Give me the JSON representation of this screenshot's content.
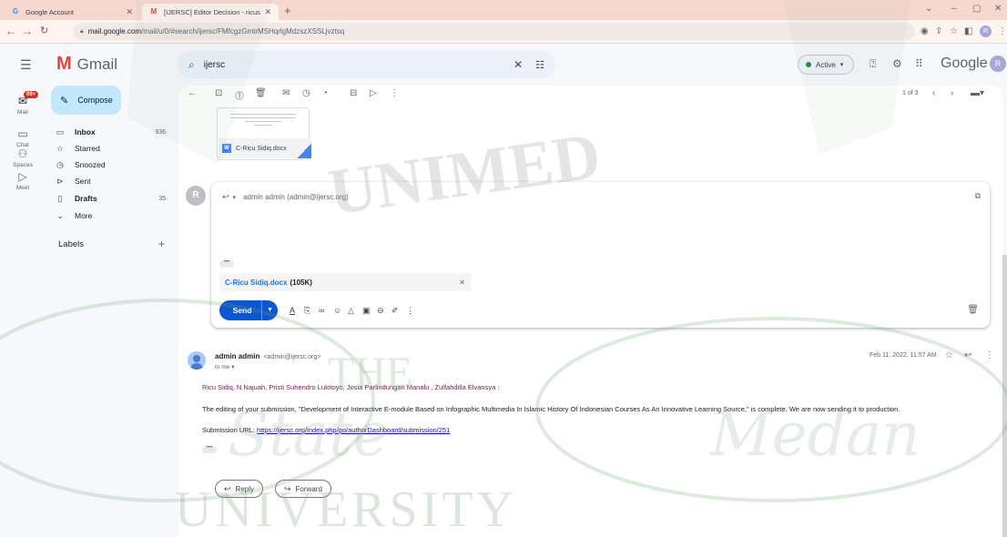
{
  "browser": {
    "tabs": [
      {
        "favicon": "G",
        "title": "Google Account"
      },
      {
        "favicon": "M",
        "title": "[IJERSC] Editor Decision - ricusid"
      }
    ],
    "url_host": "mail.google.com",
    "url_path": "/mail/u/0/#search/ijersc/FMfcgzGmtrMSHqrlgMdzszXSSLjvztsq",
    "profile_initial": "R"
  },
  "gmail": {
    "logo_text": "Gmail",
    "search_query": "ijersc",
    "status": "Active",
    "google_word": "Google",
    "avatar_initial": "R"
  },
  "rail": {
    "mail_badge": "99+",
    "items": [
      {
        "label": "Mail"
      },
      {
        "label": "Chat"
      },
      {
        "label": "Spaces"
      },
      {
        "label": "Meet"
      }
    ]
  },
  "sidebar": {
    "compose_label": "Compose",
    "items": [
      {
        "label": "Inbox",
        "count": "936"
      },
      {
        "label": "Starred",
        "count": ""
      },
      {
        "label": "Snoozed",
        "count": ""
      },
      {
        "label": "Sent",
        "count": ""
      },
      {
        "label": "Drafts",
        "count": "35"
      },
      {
        "label": "More",
        "count": ""
      }
    ],
    "labels_heading": "Labels"
  },
  "toolbar": {
    "pager": "1 of 3"
  },
  "thread": {
    "attachment_preview_name": "C-Ricu Sidiq.docx",
    "reply": {
      "avatar_initial": "R",
      "to": "admin admin (admin@ijersc.org)",
      "ellipsis": "•••",
      "file_name": "C-Ricu Sidiq.docx",
      "file_size": "(105K)",
      "send_label": "Send"
    },
    "message": {
      "sender_name": "admin admin",
      "sender_email": "<admin@ijersc.org>",
      "to_me": "to me",
      "date": "Feb 11, 2022, 11:57 AM",
      "names_line": "Ricu Sidiq, N Najuah, Pristi Suhendro Lukitoyo, Josia Parlindungan Manalu , Zulfahdilla Elvansya :",
      "body_line": "The editing of your submission, \"Development of Interactive E-module Based on Infographic Multimedia In Islamic History Of Indonesian Courses As An Innovative Learning Source,\" is complete. We are now sending it to production.",
      "url_label": "Submission URL:",
      "url": "https://ijersc.org/index.php/go/authorDashboard/submission/251",
      "ellipsis": "•••",
      "reply_label": "Reply",
      "forward_label": "Forward"
    }
  },
  "watermark": {
    "top_text": "UNIMED",
    "the_text": "THE",
    "script_left": "State",
    "script_right": "Medan",
    "bottom_text": "UNIVERSITY"
  }
}
